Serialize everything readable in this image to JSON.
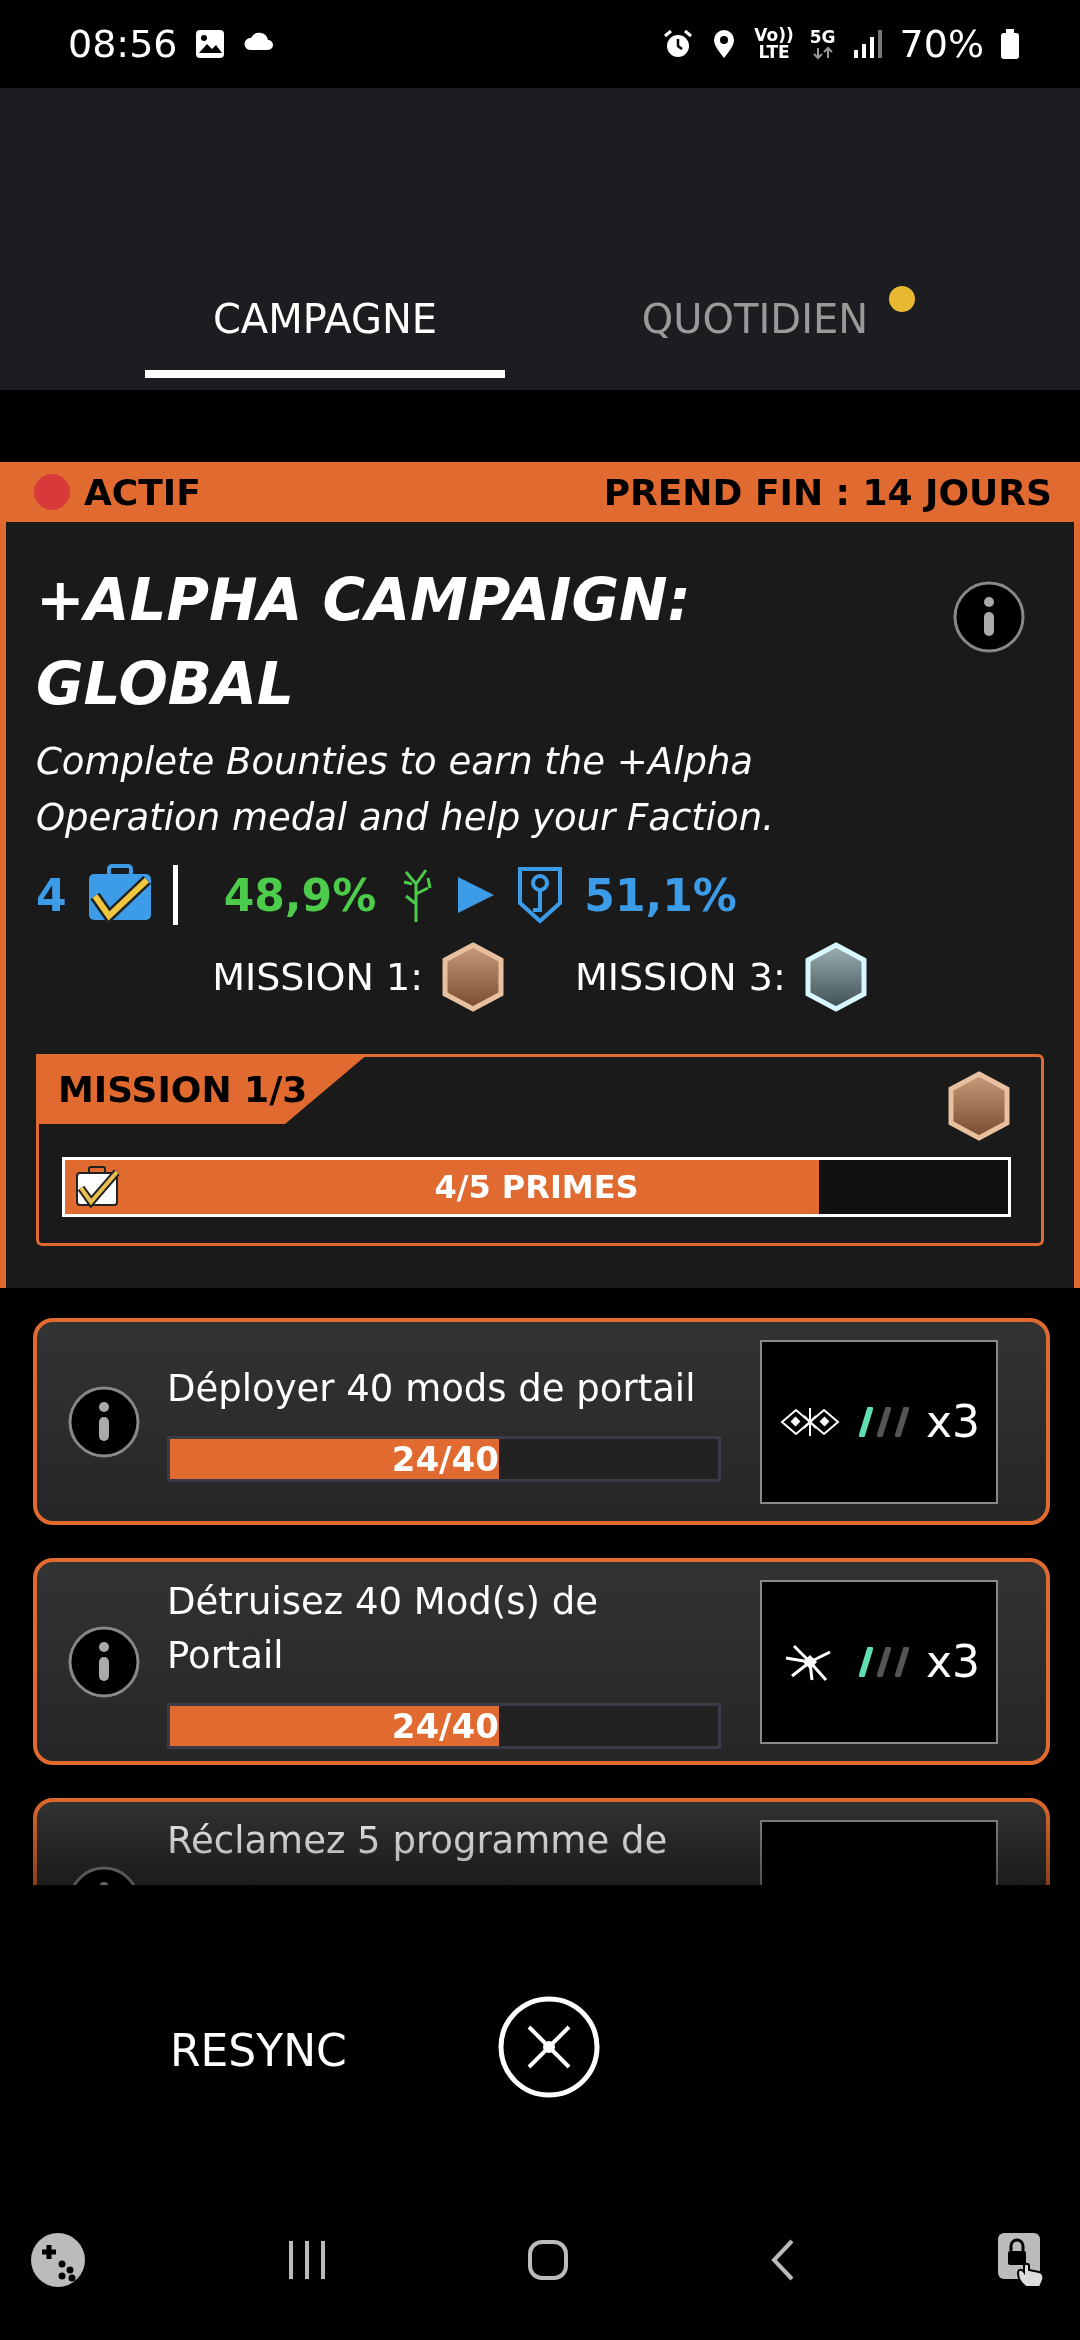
{
  "status_bar": {
    "time": "08:56",
    "volte": "Vo))",
    "lte": "LTE",
    "network": "5G",
    "battery": "70%"
  },
  "tabs": [
    {
      "label": "CAMPAGNE",
      "selected": true,
      "notification": false
    },
    {
      "label": "QUOTIDIEN",
      "selected": false,
      "notification": true
    }
  ],
  "campaign": {
    "status": "ACTIF",
    "ends": "PREND FIN : 14 JOURS",
    "title": "+ALPHA CAMPAIGN: GLOBAL",
    "description": "Complete Bounties to earn the +Alpha Operation medal and help your Faction.",
    "bounties": "4",
    "enlightened": "48,9%",
    "resistance": "51,1%",
    "rewards": [
      {
        "label": "MISSION 1:",
        "kind": "bronze"
      },
      {
        "label": "MISSION 3:",
        "kind": "platinum"
      }
    ]
  },
  "mission": {
    "label": "MISSION 1/3",
    "medal": {
      "kind": "bronze"
    },
    "progress": "4/5 PRIMES",
    "level": 0.8
  },
  "tasks": [
    {
      "title": "Déployer 40 mods de portail",
      "progress": "24/40",
      "level": 0.6,
      "kind": "deploy",
      "pips": [
        true,
        false,
        false
      ],
      "reward_count": "x3"
    },
    {
      "title": "Détruisez 40 Mod(s) de Portail",
      "progress": "24/40",
      "level": 0.6,
      "kind": "destroy",
      "pips": [
        true,
        false,
        false
      ],
      "reward_count": "x3"
    },
    {
      "title": "Réclamez 5 programme de"
    }
  ],
  "footer": {
    "resync": "RESYNC"
  }
}
